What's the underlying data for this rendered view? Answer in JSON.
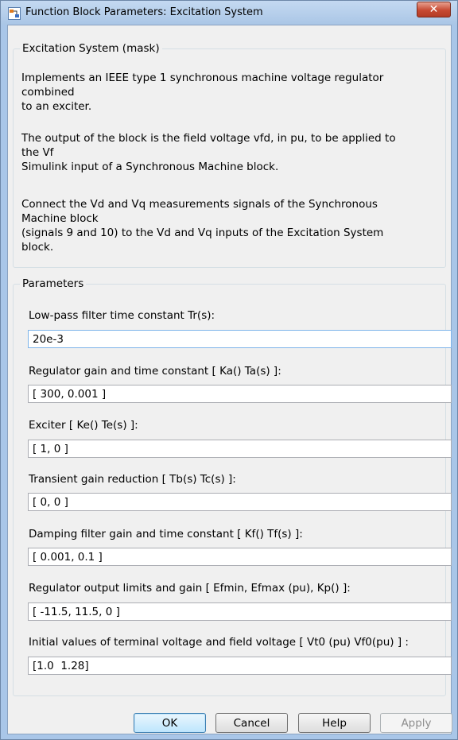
{
  "window": {
    "title": "Function Block Parameters: Excitation System",
    "close_label": "✕"
  },
  "mask": {
    "legend": "Excitation System (mask)",
    "paragraphs": [
      "Implements an IEEE type 1 synchronous machine voltage regulator\ncombined\nto an exciter.",
      "The output of the block is the field voltage vfd, in pu,  to be applied to\nthe Vf\nSimulink input of a Synchronous Machine block.",
      "Connect the Vd and Vq measurements signals of the Synchronous\nMachine block\n(signals 9 and 10)  to  the Vd and Vq inputs of the Excitation System\nblock."
    ]
  },
  "parameters": {
    "legend": "Parameters",
    "fields": [
      {
        "label": "Low-pass filter time constant Tr(s):",
        "value": "20e-3"
      },
      {
        "label": "Regulator gain and time constant [ Ka()  Ta(s) ]:",
        "value": "[ 300, 0.001 ]"
      },
      {
        "label": "Exciter  [ Ke()  Te(s) ]:",
        "value": "[ 1, 0 ]"
      },
      {
        "label": "Transient gain reduction [ Tb(s)  Tc(s) ]:",
        "value": "[ 0, 0 ]"
      },
      {
        "label": "Damping filter gain and time constant  [ Kf()  Tf(s)  ]:",
        "value": "[ 0.001, 0.1 ]"
      },
      {
        "label": "Regulator output limits and gain [ Efmin, Efmax (pu), Kp() ]:",
        "value": "[ -11.5, 11.5, 0 ]"
      },
      {
        "label": "Initial values of terminal voltage  and field voltage [ Vt0 (pu) Vf0(pu) ] :",
        "value": "[1.0  1.28]"
      }
    ]
  },
  "buttons": {
    "ok": "OK",
    "cancel": "Cancel",
    "help": "Help",
    "apply": "Apply"
  }
}
